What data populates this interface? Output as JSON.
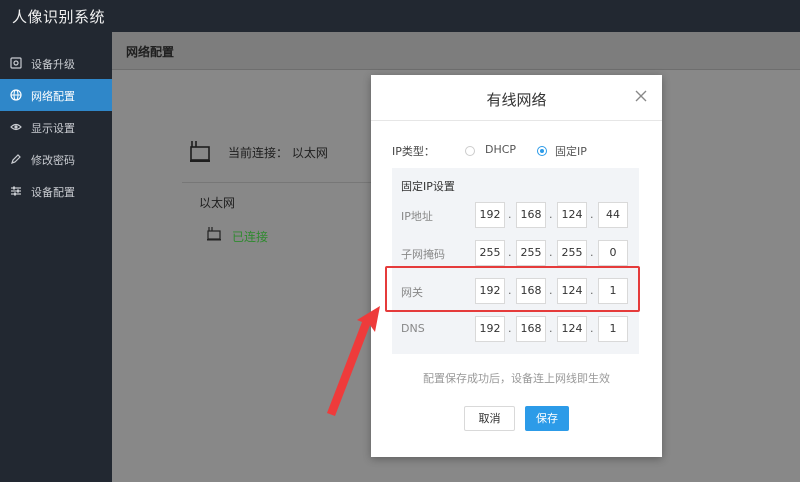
{
  "app": {
    "title": "人像识别系统"
  },
  "sidebar": {
    "items": [
      {
        "label": "设备升级",
        "icon": "upgrade-icon"
      },
      {
        "label": "网络配置",
        "icon": "globe-icon",
        "active": true
      },
      {
        "label": "显示设置",
        "icon": "eye-icon"
      },
      {
        "label": "修改密码",
        "icon": "edit-icon"
      },
      {
        "label": "设备配置",
        "icon": "sliders-icon"
      }
    ]
  },
  "main": {
    "title": "网络配置",
    "connection_label": "当前连接： 以太网",
    "ethernet_title": "以太网",
    "ethernet_status": "已连接"
  },
  "dialog": {
    "title": "有线网络",
    "ip_type_label": "IP类型：",
    "ip_type_options": [
      "DHCP",
      "固定IP"
    ],
    "ip_type_selected": "固定IP",
    "panel_title": "固定IP设置",
    "fields": [
      {
        "label": "IP地址",
        "octets": [
          "192",
          "168",
          "124",
          "44"
        ]
      },
      {
        "label": "子网掩码",
        "octets": [
          "255",
          "255",
          "255",
          "0"
        ]
      },
      {
        "label": "网关",
        "octets": [
          "192",
          "168",
          "124",
          "1"
        ]
      },
      {
        "label": "DNS",
        "octets": [
          "192",
          "168",
          "124",
          "1"
        ]
      }
    ],
    "octet_separator": ".",
    "hint": "配置保存成功后，设备连上网线即生效",
    "cancel_label": "取消",
    "save_label": "保存"
  },
  "colors": {
    "accent": "#2c9be8",
    "sidebar_active": "#2f87c9",
    "highlight": "#e53b3b",
    "success": "#2f8a2f"
  }
}
